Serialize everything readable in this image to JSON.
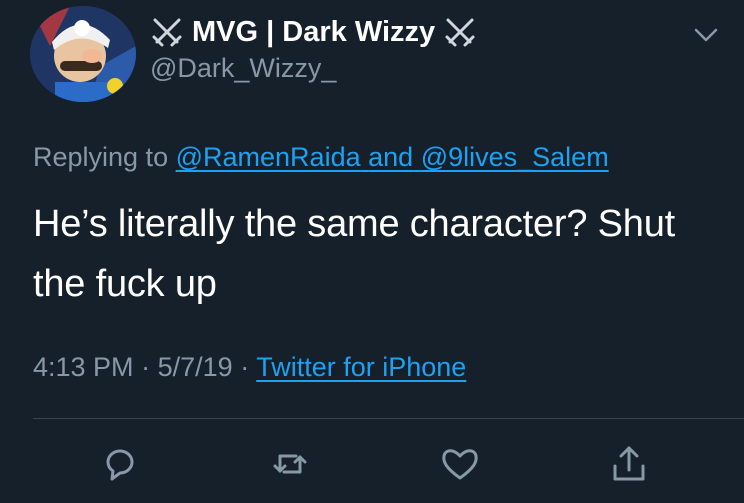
{
  "tweet": {
    "display_name": "MVG | Dark Wizzy",
    "handle": "@Dark_Wizzy_",
    "replying_prefix": "Replying to",
    "reply_mention_1": "@RamenRaida",
    "reply_conjunction": "and",
    "reply_mention_2": "@9lives_Salem",
    "text_line_1": "He’s literally the same character? Shut",
    "text_line_2": "the fuck up",
    "time": "4:13 PM",
    "sep": "·",
    "date": "5/7/19",
    "source": "Twitter for iPhone"
  },
  "icons": {
    "name_decorations": [
      "crossed-swords-icon",
      "crossed-swords-icon"
    ],
    "menu": "chevron-down-icon",
    "actions": [
      "reply-icon",
      "retweet-icon",
      "like-icon",
      "share-icon"
    ]
  },
  "colors": {
    "background": "#15202b",
    "text": "#ffffff",
    "muted": "#8899a6",
    "link": "#1da1f2",
    "divider": "#38444d"
  }
}
